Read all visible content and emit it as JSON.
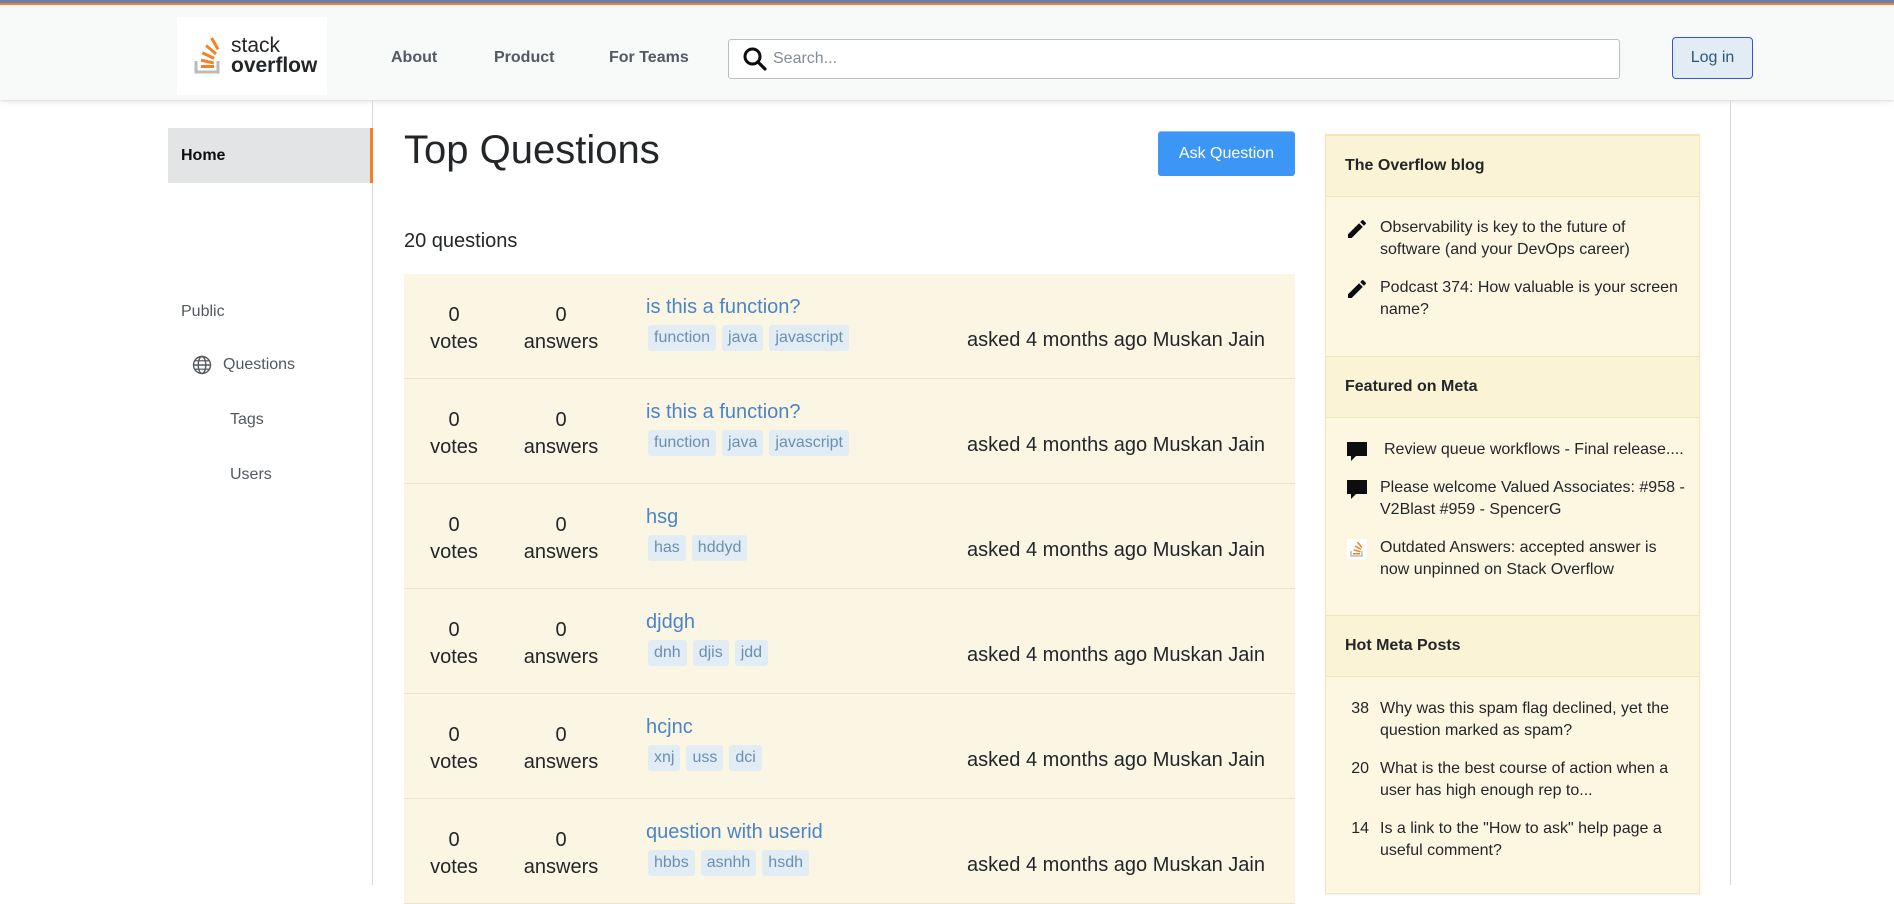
{
  "header": {
    "logo_line1": "stack",
    "logo_line2": "overflow",
    "nav": [
      "About",
      "Product",
      "For Teams"
    ],
    "search_placeholder": "Search...",
    "login_label": "Log in"
  },
  "sidebar": {
    "home": "Home",
    "public": "Public",
    "questions": "Questions",
    "tags": "Tags",
    "users": "Users"
  },
  "main": {
    "title": "Top Questions",
    "ask_button": "Ask Question",
    "count_label": "20 questions",
    "questions": [
      {
        "votes": "0",
        "votes_label": "votes",
        "answers": "0",
        "answers_label": "answers",
        "title": "is this a function?",
        "tags": [
          "function",
          "java",
          "javascript"
        ],
        "meta": "asked 4 months ago Muskan Jain"
      },
      {
        "votes": "0",
        "votes_label": "votes",
        "answers": "0",
        "answers_label": "answers",
        "title": "is this a function?",
        "tags": [
          "function",
          "java",
          "javascript"
        ],
        "meta": "asked 4 months ago Muskan Jain"
      },
      {
        "votes": "0",
        "votes_label": "votes",
        "answers": "0",
        "answers_label": "answers",
        "title": "hsg",
        "tags": [
          "has",
          "hddyd"
        ],
        "meta": "asked 4 months ago Muskan Jain"
      },
      {
        "votes": "0",
        "votes_label": "votes",
        "answers": "0",
        "answers_label": "answers",
        "title": "djdgh",
        "tags": [
          "dnh",
          "djis",
          "jdd"
        ],
        "meta": "asked 4 months ago Muskan Jain"
      },
      {
        "votes": "0",
        "votes_label": "votes",
        "answers": "0",
        "answers_label": "answers",
        "title": "hcjnc",
        "tags": [
          "xnj",
          "uss",
          "dci"
        ],
        "meta": "asked 4 months ago Muskan Jain"
      },
      {
        "votes": "0",
        "votes_label": "votes",
        "answers": "0",
        "answers_label": "answers",
        "title": "question with userid",
        "tags": [
          "hbbs",
          "asnhh",
          "hsdh"
        ],
        "meta": "asked 4 months ago Muskan Jain"
      }
    ]
  },
  "widget": {
    "blog_title": "The Overflow blog",
    "blog_items": [
      {
        "icon": "pencil-icon",
        "text": "Observability is key to the future of software (and your DevOps career)"
      },
      {
        "icon": "pencil-icon",
        "text": "Podcast 374: How valuable is your screen name?"
      }
    ],
    "meta_title": "Featured on Meta",
    "meta_items": [
      {
        "icon": "speech-bubble-icon",
        "text": "Review queue workflows - Final release...."
      },
      {
        "icon": "speech-bubble-icon",
        "text": "Please welcome Valued Associates: #958 - V2Blast #959 - SpencerG"
      },
      {
        "icon": "stackoverflow-icon",
        "text": "Outdated Answers: accepted answer is now unpinned on Stack Overflow"
      }
    ],
    "hot_title": "Hot Meta Posts",
    "hot_items": [
      {
        "count": "38",
        "text": "Why was this spam flag declined, yet the question marked as spam?"
      },
      {
        "count": "20",
        "text": "What is the best course of action when a user has high enough rep to..."
      },
      {
        "count": "14",
        "text": "Is a link to the \"How to ask\" help page a useful comment?"
      }
    ]
  },
  "colors": {
    "accent": "#f48225",
    "ask_button": "#3b96f5",
    "row_bg": "#fbf6e4",
    "widget_bg": "#fdf7e2",
    "link": "#4b84c7",
    "tag_bg": "#e1ecf4"
  }
}
